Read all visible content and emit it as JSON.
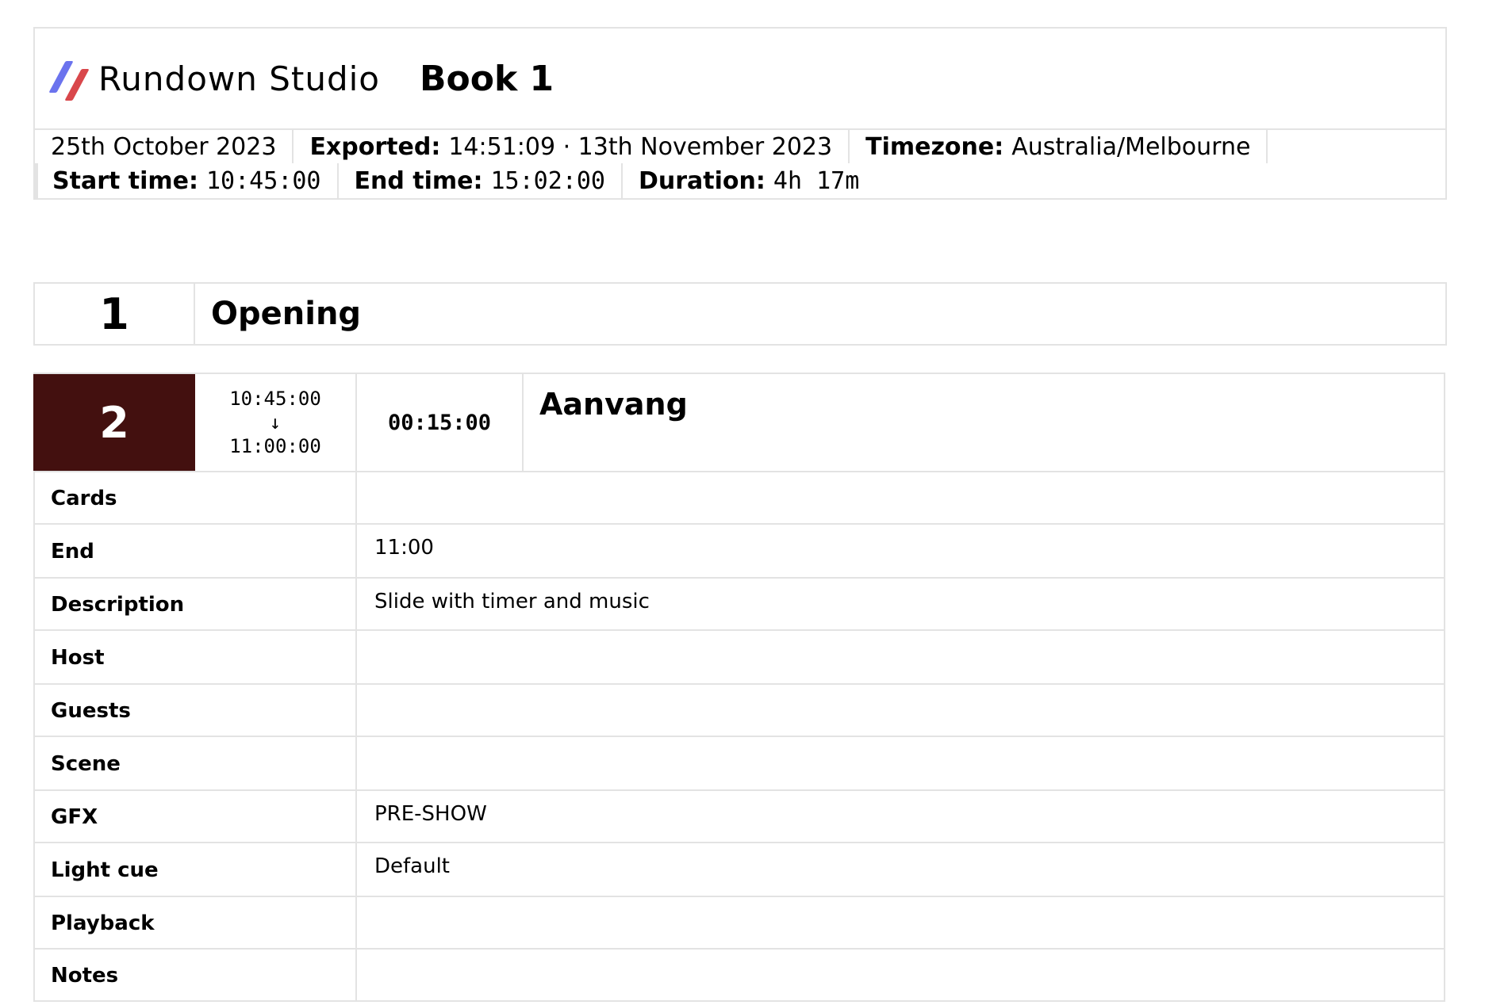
{
  "header": {
    "brand_name": "Rundown Studio",
    "book_title": "Book 1",
    "date": "25th October 2023",
    "exported_label": "Exported:",
    "exported_value": "14:51:09 · 13th November 2023",
    "timezone_label": "Timezone:",
    "timezone_value": "Australia/Melbourne",
    "start_label": "Start time:",
    "start_value": "10:45:00",
    "end_label": "End time:",
    "end_value": "15:02:00",
    "duration_label": "Duration:",
    "duration_value": "4h 17m",
    "logo_colors": [
      "#6b73ee",
      "#d9474b"
    ]
  },
  "segment": {
    "number": "1",
    "title": "Opening"
  },
  "item": {
    "number": "2",
    "number_bg": "#43100f",
    "start": "10:45:00",
    "arrow": "↓",
    "end": "11:00:00",
    "duration": "00:15:00",
    "title": "Aanvang",
    "fields": [
      {
        "label": "Cards",
        "value": ""
      },
      {
        "label": "End",
        "value": "11:00"
      },
      {
        "label": "Description",
        "value": "Slide with timer and music"
      },
      {
        "label": "Host",
        "value": ""
      },
      {
        "label": "Guests",
        "value": ""
      },
      {
        "label": "Scene",
        "value": ""
      },
      {
        "label": "GFX",
        "value": "PRE-SHOW"
      },
      {
        "label": "Light cue",
        "value": "Default"
      },
      {
        "label": "Playback",
        "value": ""
      },
      {
        "label": "Notes",
        "value": ""
      }
    ]
  }
}
